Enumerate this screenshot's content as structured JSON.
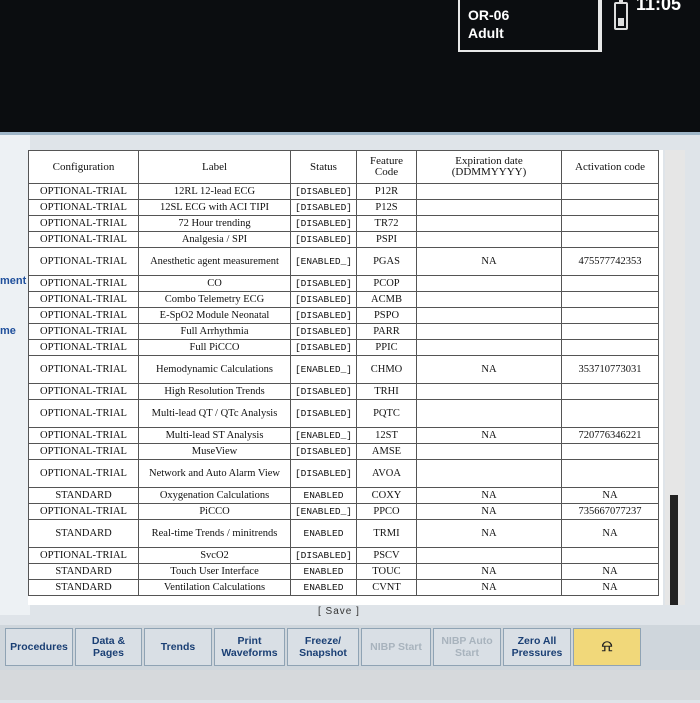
{
  "monitor": {
    "bed": "OR-06",
    "patient_type": "Adult",
    "clock": "11:05",
    "battery_icon": "battery-icon"
  },
  "left_labels": [
    "ment",
    "me"
  ],
  "table": {
    "headers": [
      "Configuration",
      "Label",
      "Status",
      "Feature Code",
      "Expiration date (DDMMYYYY)",
      "Activation code"
    ],
    "rows": [
      {
        "config": "OPTIONAL-TRIAL",
        "label": "12RL 12-lead ECG",
        "status": "[DISABLED]",
        "code": "P12R",
        "exp": "",
        "act": ""
      },
      {
        "config": "OPTIONAL-TRIAL",
        "label": "12SL ECG with ACI TIPI",
        "status": "[DISABLED]",
        "code": "P12S",
        "exp": "",
        "act": ""
      },
      {
        "config": "OPTIONAL-TRIAL",
        "label": "72 Hour trending",
        "status": "[DISABLED]",
        "code": "TR72",
        "exp": "",
        "act": ""
      },
      {
        "config": "OPTIONAL-TRIAL",
        "label": "Analgesia / SPI",
        "status": "[DISABLED]",
        "code": "PSPI",
        "exp": "",
        "act": ""
      },
      {
        "config": "OPTIONAL-TRIAL",
        "label": "Anesthetic agent measurement",
        "status": "[ENABLED_]",
        "code": "PGAS",
        "exp": "NA",
        "act": "475577742353"
      },
      {
        "config": "OPTIONAL-TRIAL",
        "label": "CO",
        "status": "[DISABLED]",
        "code": "PCOP",
        "exp": "",
        "act": ""
      },
      {
        "config": "OPTIONAL-TRIAL",
        "label": "Combo Telemetry ECG",
        "status": "[DISABLED]",
        "code": "ACMB",
        "exp": "",
        "act": ""
      },
      {
        "config": "OPTIONAL-TRIAL",
        "label": "E-SpO2 Module Neonatal",
        "status": "[DISABLED]",
        "code": "PSPO",
        "exp": "",
        "act": ""
      },
      {
        "config": "OPTIONAL-TRIAL",
        "label": "Full Arrhythmia",
        "status": "[DISABLED]",
        "code": "PARR",
        "exp": "",
        "act": ""
      },
      {
        "config": "OPTIONAL-TRIAL",
        "label": "Full PiCCO",
        "status": "[DISABLED]",
        "code": "PPIC",
        "exp": "",
        "act": ""
      },
      {
        "config": "OPTIONAL-TRIAL",
        "label": "Hemodynamic Calculations",
        "status": "[ENABLED_]",
        "code": "CHMO",
        "exp": "NA",
        "act": "353710773031"
      },
      {
        "config": "OPTIONAL-TRIAL",
        "label": "High Resolution Trends",
        "status": "[DISABLED]",
        "code": "TRHI",
        "exp": "",
        "act": ""
      },
      {
        "config": "OPTIONAL-TRIAL",
        "label": "Multi-lead QT / QTc Analysis",
        "status": "[DISABLED]",
        "code": "PQTC",
        "exp": "",
        "act": ""
      },
      {
        "config": "OPTIONAL-TRIAL",
        "label": "Multi-lead ST Analysis",
        "status": "[ENABLED_]",
        "code": "12ST",
        "exp": "NA",
        "act": "720776346221"
      },
      {
        "config": "OPTIONAL-TRIAL",
        "label": "MuseView",
        "status": "[DISABLED]",
        "code": "AMSE",
        "exp": "",
        "act": ""
      },
      {
        "config": "OPTIONAL-TRIAL",
        "label": "Network and Auto Alarm View",
        "status": "[DISABLED]",
        "code": "AVOA",
        "exp": "",
        "act": ""
      },
      {
        "config": "STANDARD",
        "label": "Oxygenation Calculations",
        "status": "ENABLED",
        "code": "COXY",
        "exp": "NA",
        "act": "NA"
      },
      {
        "config": "OPTIONAL-TRIAL",
        "label": "PiCCO",
        "status": "[ENABLED_]",
        "code": "PPCO",
        "exp": "NA",
        "act": "735667077237"
      },
      {
        "config": "STANDARD",
        "label": "Real-time Trends / minitrends",
        "status": "ENABLED",
        "code": "TRMI",
        "exp": "NA",
        "act": "NA"
      },
      {
        "config": "OPTIONAL-TRIAL",
        "label": "SvcO2",
        "status": "[DISABLED]",
        "code": "PSCV",
        "exp": "",
        "act": ""
      },
      {
        "config": "STANDARD",
        "label": "Touch User Interface",
        "status": "ENABLED",
        "code": "TOUC",
        "exp": "NA",
        "act": "NA"
      },
      {
        "config": "STANDARD",
        "label": "Ventilation Calculations",
        "status": "ENABLED",
        "code": "CVNT",
        "exp": "NA",
        "act": "NA"
      }
    ]
  },
  "save_label": "[ Save ]",
  "buttons": [
    {
      "label": "Procedures",
      "state": "enabled"
    },
    {
      "label": "Data & Pages",
      "state": "enabled"
    },
    {
      "label": "Trends",
      "state": "enabled"
    },
    {
      "label": "Print Waveforms",
      "state": "enabled"
    },
    {
      "label": "Freeze/ Snapshot",
      "state": "enabled"
    },
    {
      "label": "NIBP Start",
      "state": "disabled"
    },
    {
      "label": "NIBP Auto Start",
      "state": "disabled"
    },
    {
      "label": "Zero All Pressures",
      "state": "enabled"
    },
    {
      "label": "",
      "state": "alarm",
      "icon": "bell-icon"
    }
  ]
}
